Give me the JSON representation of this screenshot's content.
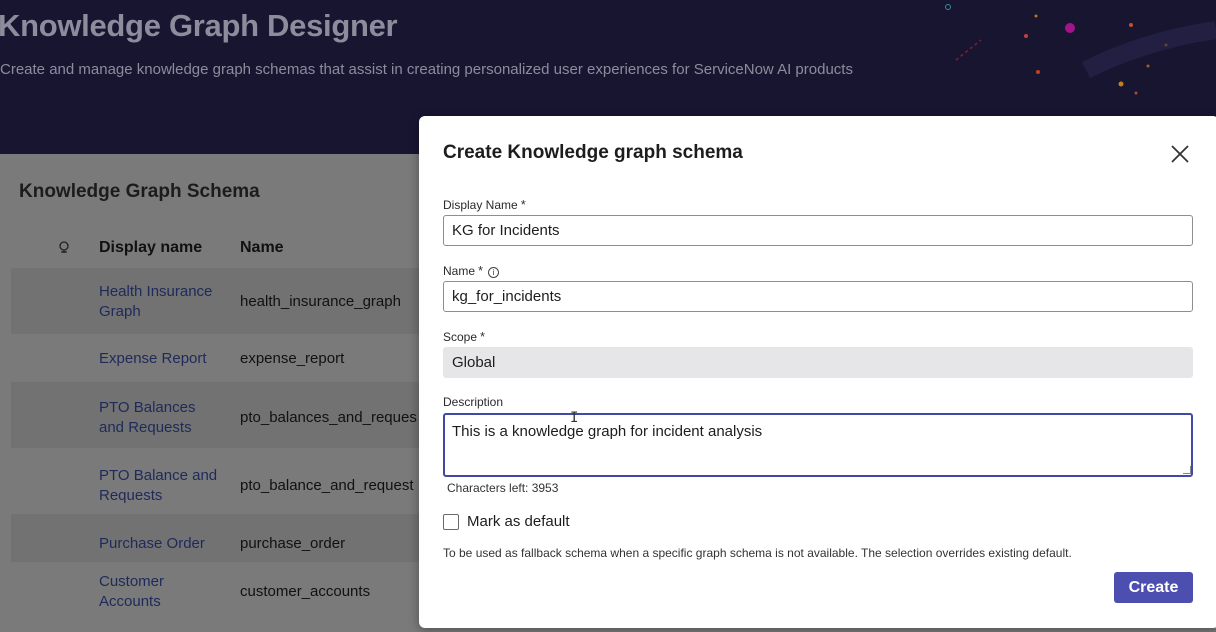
{
  "header": {
    "title": "Knowledge Graph Designer",
    "subtitle": "Create and manage knowledge graph schemas that assist in creating personalized user experiences for ServiceNow AI products"
  },
  "schema_list": {
    "title": "Knowledge Graph Schema",
    "columns": [
      "Display name",
      "Name"
    ],
    "rows": [
      {
        "display_name": "Health Insurance Graph",
        "display_lines": [
          "Health Insurance",
          "Graph"
        ],
        "name": "health_insurance_graph"
      },
      {
        "display_name": "Expense Report",
        "display_lines": [
          "Expense Report"
        ],
        "name": "expense_report"
      },
      {
        "display_name": "PTO Balances and Requests",
        "display_lines": [
          "PTO Balances",
          "and Requests"
        ],
        "name": "pto_balances_and_reques"
      },
      {
        "display_name": "PTO Balance and Requests",
        "display_lines": [
          "PTO Balance and",
          "Requests"
        ],
        "name": "pto_balance_and_request"
      },
      {
        "display_name": "Purchase Order",
        "display_lines": [
          "Purchase Order"
        ],
        "name": "purchase_order"
      },
      {
        "display_name": "Customer Accounts",
        "display_lines": [
          "Customer",
          "Accounts"
        ],
        "name": "customer_accounts"
      }
    ]
  },
  "modal": {
    "title": "Create Knowledge graph schema",
    "display_name": {
      "label": "Display Name",
      "value": "KG for Incidents"
    },
    "name": {
      "label": "Name",
      "value": "kg_for_incidents"
    },
    "scope": {
      "label": "Scope",
      "value": "Global"
    },
    "description": {
      "label": "Description",
      "value": "This is a knowledge graph for incident analysis"
    },
    "chars_left": "Characters left: 3953",
    "mark_default": {
      "label": "Mark as default",
      "checked": false
    },
    "help_text": "To be used as fallback schema when a specific graph schema is not available. The selection overrides existing default.",
    "create_label": "Create",
    "required_mark": "*",
    "info_mark": "i"
  },
  "colors": {
    "banner": "#181531",
    "accent": "#4c4fb0",
    "focus_border": "#3f4ba3",
    "link": "#1e2a5a"
  }
}
